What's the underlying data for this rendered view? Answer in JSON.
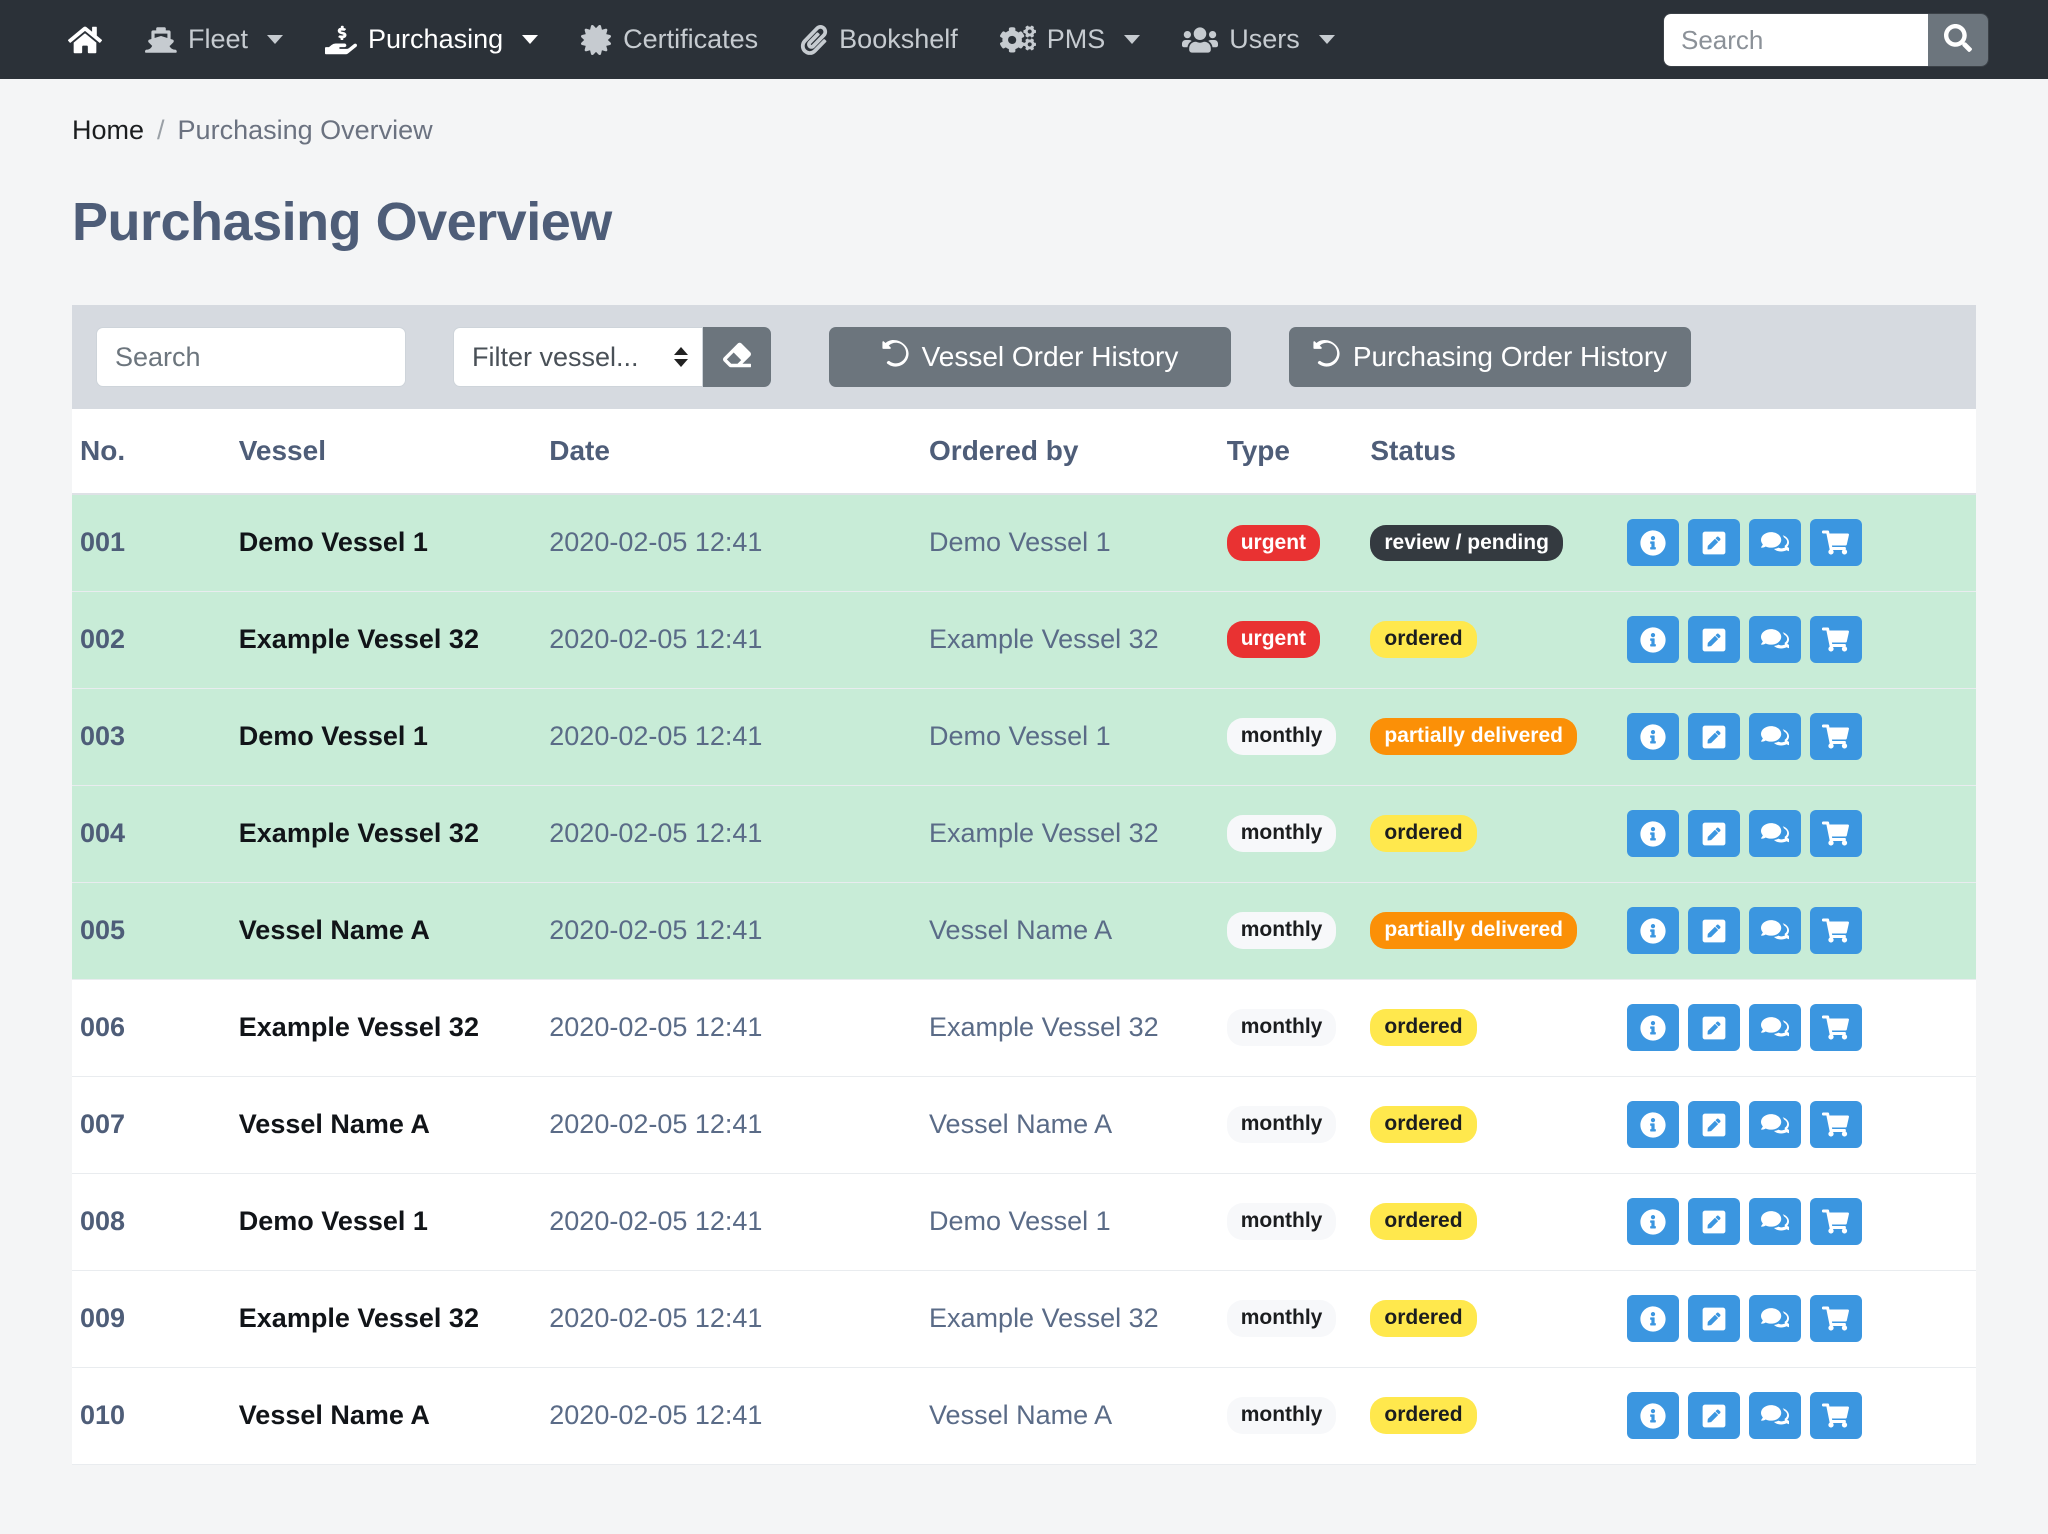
{
  "navbar": {
    "items": [
      {
        "label": "",
        "icon": "home-icon",
        "key": "home",
        "caret": false
      },
      {
        "label": "Fleet",
        "icon": "ship-icon",
        "key": "fleet",
        "caret": true
      },
      {
        "label": "Purchasing",
        "icon": "hand-holding-dollar-icon",
        "key": "purchasing",
        "caret": true
      },
      {
        "label": "Certificates",
        "icon": "certificate-icon",
        "key": "certificates",
        "caret": false
      },
      {
        "label": "Bookshelf",
        "icon": "paperclip-icon",
        "key": "bookshelf",
        "caret": false
      },
      {
        "label": "PMS",
        "icon": "cogs-icon",
        "key": "pms",
        "caret": true
      },
      {
        "label": "Users",
        "icon": "users-icon",
        "key": "users",
        "caret": true
      }
    ],
    "search": {
      "value": "",
      "placeholder": "Search",
      "button_icon": "search-icon"
    }
  },
  "breadcrumb": {
    "home": "Home",
    "separator": "/",
    "current": "Purchasing Overview"
  },
  "page": {
    "title": "Purchasing Overview"
  },
  "toolbar": {
    "search": {
      "value": "",
      "placeholder": "Search"
    },
    "vessel_filter": {
      "selected": "Filter vessel...",
      "options": [
        "Filter vessel..."
      ]
    },
    "clear_button": {
      "icon": "eraser-icon",
      "label": ""
    },
    "vessel_order_history": {
      "label": "Vessel Order History",
      "icon": "history-icon"
    },
    "purchasing_order_history": {
      "label": "Purchasing Order History",
      "icon": "history-icon"
    }
  },
  "table": {
    "columns": [
      "No.",
      "Vessel",
      "Date",
      "Ordered by",
      "Type",
      "Status",
      ""
    ],
    "row_actions": [
      {
        "name": "info-button",
        "icon": "info-circle-icon"
      },
      {
        "name": "edit-button",
        "icon": "pen-square-icon"
      },
      {
        "name": "quote-button",
        "icon": "comment-dollar-icon"
      },
      {
        "name": "cart-button",
        "icon": "shopping-cart-icon"
      }
    ],
    "rows": [
      {
        "no": "001",
        "vessel": "Demo Vessel 1",
        "date": "2020-02-05 12:41",
        "ordered_by": "Demo Vessel 1",
        "type": "urgent",
        "type_style": "urgent",
        "status": "review / pending",
        "status_style": "pending",
        "highlight": true
      },
      {
        "no": "002",
        "vessel": "Example Vessel 32",
        "date": "2020-02-05 12:41",
        "ordered_by": "Example Vessel 32",
        "type": "urgent",
        "type_style": "urgent",
        "status": "ordered",
        "status_style": "ordered",
        "highlight": true
      },
      {
        "no": "003",
        "vessel": "Demo Vessel 1",
        "date": "2020-02-05 12:41",
        "ordered_by": "Demo Vessel 1",
        "type": "monthly",
        "type_style": "monthly",
        "status": "partially delivered",
        "status_style": "partial",
        "highlight": true
      },
      {
        "no": "004",
        "vessel": "Example Vessel 32",
        "date": "2020-02-05 12:41",
        "ordered_by": "Example Vessel 32",
        "type": "monthly",
        "type_style": "monthly",
        "status": "ordered",
        "status_style": "ordered",
        "highlight": true
      },
      {
        "no": "005",
        "vessel": "Vessel Name A",
        "date": "2020-02-05 12:41",
        "ordered_by": "Vessel Name A",
        "type": "monthly",
        "type_style": "monthly",
        "status": "partially delivered",
        "status_style": "partial",
        "highlight": true
      },
      {
        "no": "006",
        "vessel": "Example Vessel 32",
        "date": "2020-02-05 12:41",
        "ordered_by": "Example Vessel 32",
        "type": "monthly",
        "type_style": "monthly",
        "status": "ordered",
        "status_style": "ordered",
        "highlight": false
      },
      {
        "no": "007",
        "vessel": "Vessel Name A",
        "date": "2020-02-05 12:41",
        "ordered_by": "Vessel Name A",
        "type": "monthly",
        "type_style": "monthly",
        "status": "ordered",
        "status_style": "ordered",
        "highlight": false
      },
      {
        "no": "008",
        "vessel": "Demo Vessel 1",
        "date": "2020-02-05 12:41",
        "ordered_by": "Demo Vessel 1",
        "type": "monthly",
        "type_style": "monthly",
        "status": "ordered",
        "status_style": "ordered",
        "highlight": false
      },
      {
        "no": "009",
        "vessel": "Example Vessel 32",
        "date": "2020-02-05 12:41",
        "ordered_by": "Example Vessel 32",
        "type": "monthly",
        "type_style": "monthly",
        "status": "ordered",
        "status_style": "ordered",
        "highlight": false
      },
      {
        "no": "010",
        "vessel": "Vessel Name A",
        "date": "2020-02-05 12:41",
        "ordered_by": "Vessel Name A",
        "type": "monthly",
        "type_style": "monthly",
        "status": "ordered",
        "status_style": "ordered",
        "highlight": false
      }
    ]
  },
  "colors": {
    "navbar_bg": "#2b3138",
    "title": "#4e5d78",
    "toolbar_bg": "#d6dae0",
    "button_secondary": "#6c757d",
    "row_highlight": "#c8ecd7",
    "action_blue": "#3b96e0",
    "badge_urgent": "#e93232",
    "badge_ordered": "#ffe84d",
    "badge_partial": "#fb9007",
    "badge_pending": "#343a40"
  }
}
